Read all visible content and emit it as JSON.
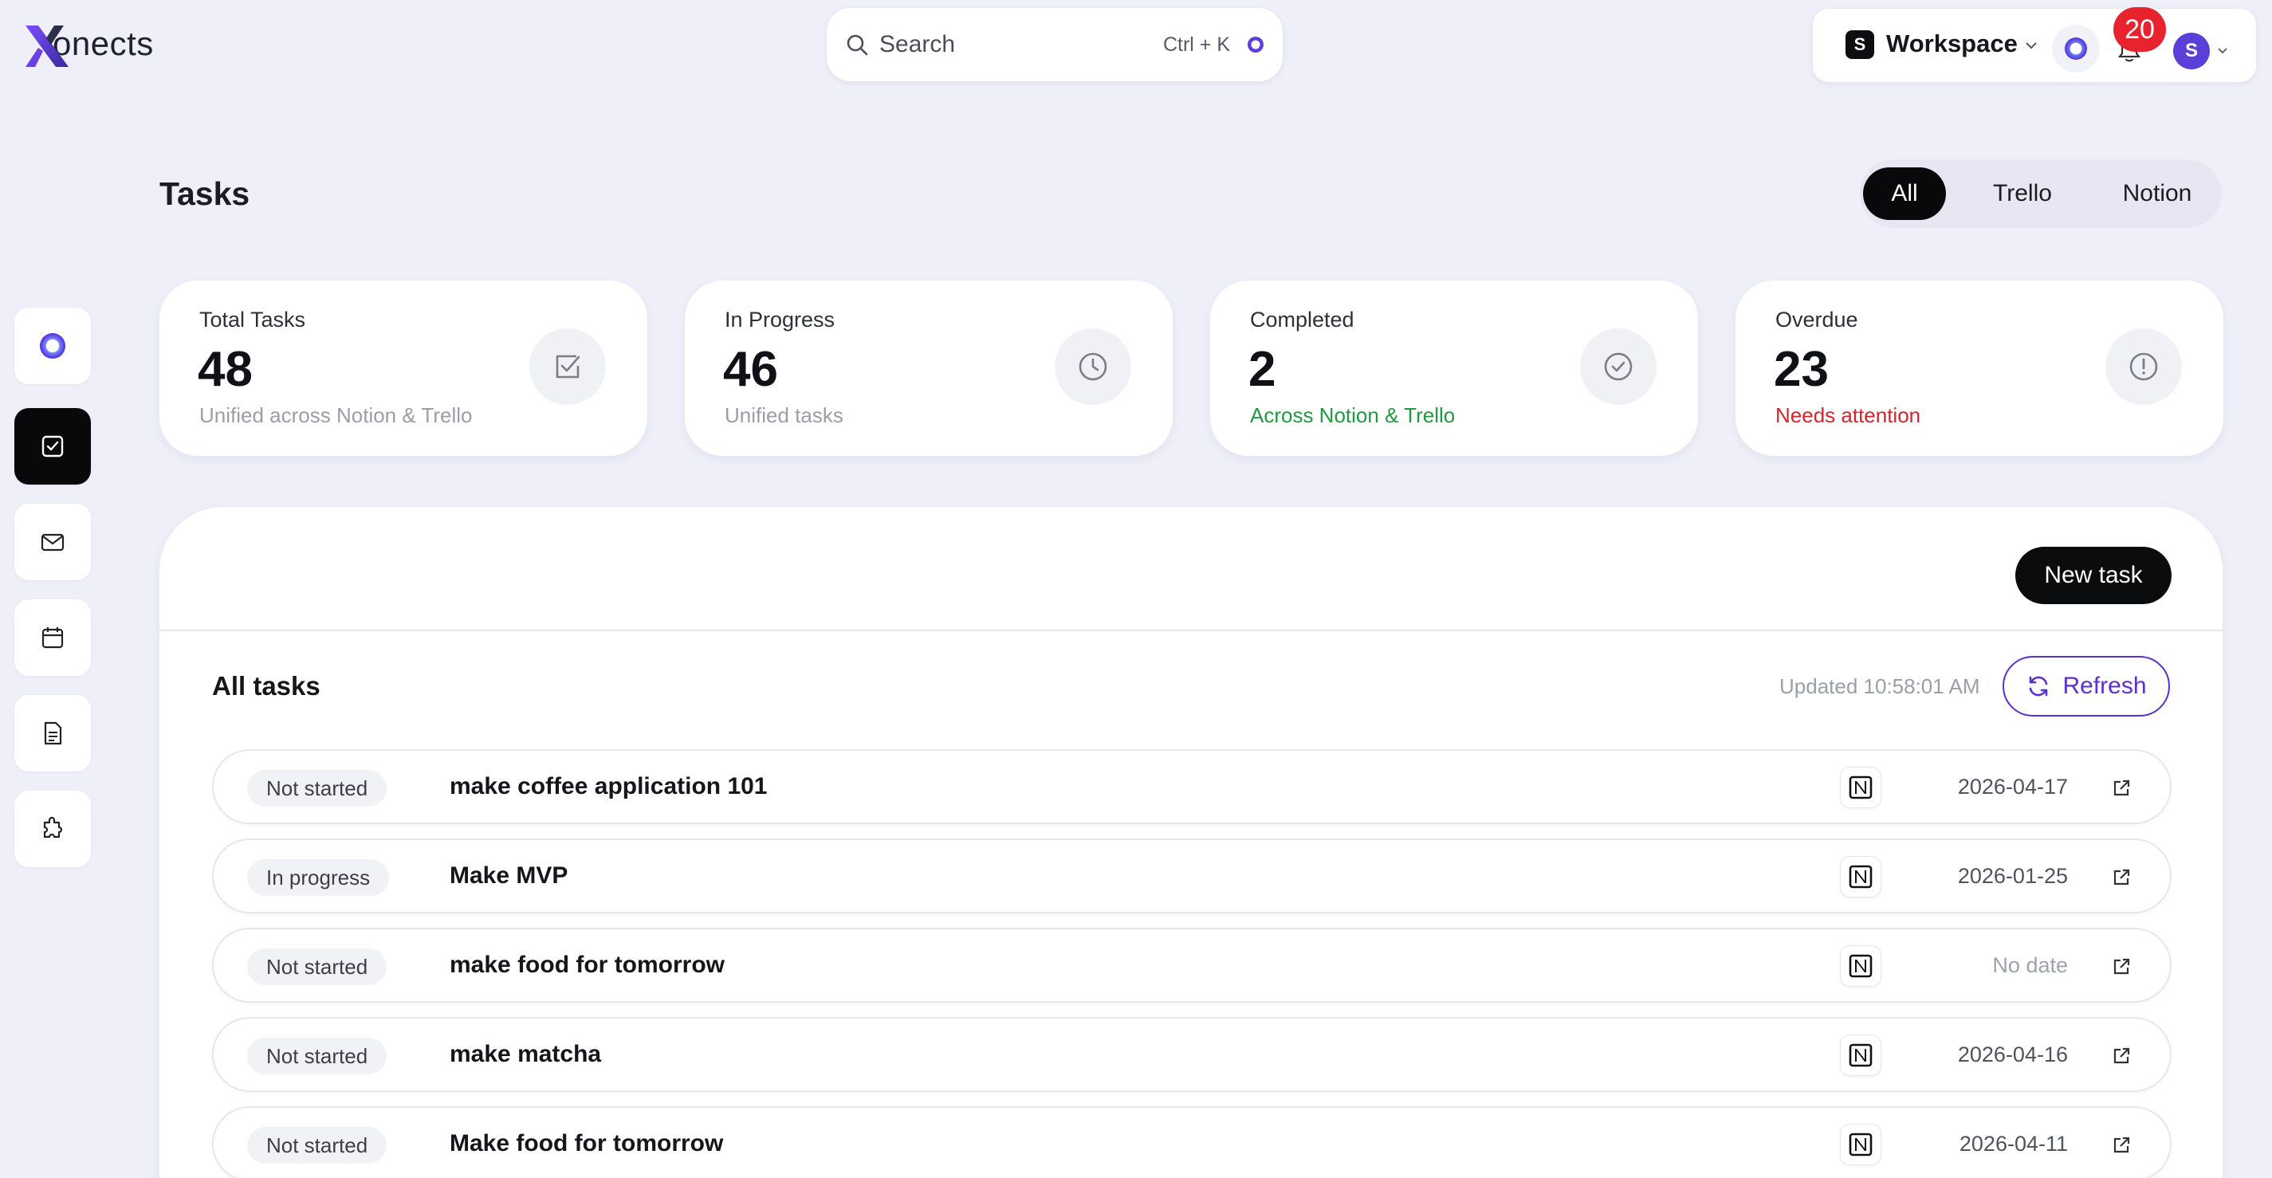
{
  "app": {
    "logo_text": "onects",
    "logo_mark": "X"
  },
  "search": {
    "placeholder": "Search",
    "shortcut": "Ctrl + K"
  },
  "workspace": {
    "badge": "S",
    "label": "Workspace",
    "notifications": "20",
    "avatar_initial": "S"
  },
  "sidebar": {
    "items": [
      {
        "icon": "orb-icon",
        "active": false
      },
      {
        "icon": "tasks-icon",
        "active": true
      },
      {
        "icon": "mail-icon",
        "active": false
      },
      {
        "icon": "calendar-icon",
        "active": false
      },
      {
        "icon": "document-icon",
        "active": false
      },
      {
        "icon": "integrations-icon",
        "active": false
      }
    ]
  },
  "page": {
    "title": "Tasks",
    "filters": [
      "All",
      "Trello",
      "Notion"
    ],
    "active_filter": "All"
  },
  "stats": [
    {
      "label": "Total Tasks",
      "value": "48",
      "sub": "Unified across Notion & Trello",
      "icon": "checkbox-icon"
    },
    {
      "label": "In Progress",
      "value": "46",
      "sub": "Unified tasks",
      "icon": "clock-icon"
    },
    {
      "label": "Completed",
      "value": "2",
      "sub": "Across Notion & Trello",
      "icon": "check-circle-icon"
    },
    {
      "label": "Overdue",
      "value": "23",
      "sub": "Needs attention",
      "icon": "alert-circle-icon"
    }
  ],
  "tasks_panel": {
    "new_task_label": "New task",
    "heading": "All tasks",
    "updated": "Updated 10:58:01 AM",
    "refresh_label": "Refresh",
    "rows": [
      {
        "status": "Not started",
        "title": "make coffee application 101",
        "source": "Notion",
        "date": "2026-04-17"
      },
      {
        "status": "In progress",
        "title": "Make MVP",
        "source": "Notion",
        "date": "2026-01-25"
      },
      {
        "status": "Not started",
        "title": "make food for tomorrow",
        "source": "Notion",
        "date": "No date"
      },
      {
        "status": "Not started",
        "title": "make matcha",
        "source": "Notion",
        "date": "2026-04-16"
      },
      {
        "status": "Not started",
        "title": "Make food for tomorrow",
        "source": "Notion",
        "date": "2026-04-11"
      }
    ]
  },
  "colors": {
    "background": "#eeeff9",
    "accent": "#5b2fd6",
    "green": "#1f9a3e",
    "red": "#d8232a",
    "badge_red": "#e8232d"
  }
}
